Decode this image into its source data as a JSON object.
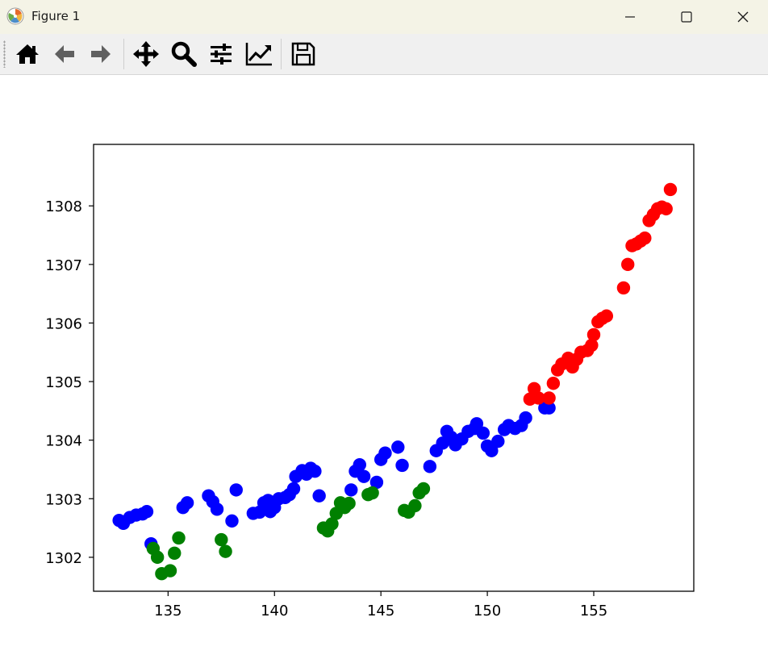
{
  "window": {
    "title": "Figure 1",
    "app_icon": "matplotlib-icon",
    "controls": [
      "minimize-icon",
      "maximize-icon",
      "close-icon"
    ]
  },
  "toolbar": {
    "buttons": [
      {
        "name": "home-button",
        "icon": "home-icon"
      },
      {
        "name": "back-button",
        "icon": "arrow-left-icon"
      },
      {
        "name": "forward-button",
        "icon": "arrow-right-icon"
      },
      {
        "name": "pan-button",
        "icon": "move-icon"
      },
      {
        "name": "zoom-button",
        "icon": "magnifier-icon"
      },
      {
        "name": "subplots-button",
        "icon": "sliders-icon"
      },
      {
        "name": "edit-axis-button",
        "icon": "line-chart-icon"
      },
      {
        "name": "save-button",
        "icon": "floppy-disk-icon"
      }
    ]
  },
  "chart_data": {
    "type": "scatter",
    "xlim": [
      131.5,
      159.7
    ],
    "ylim": [
      1301.42,
      1309.05
    ],
    "x_ticks": [
      135,
      140,
      145,
      150,
      155
    ],
    "y_ticks": [
      1302,
      1303,
      1304,
      1305,
      1306,
      1307,
      1308
    ],
    "grid": false,
    "series": [
      {
        "color": "#0000ff",
        "points": [
          [
            132.7,
            1302.63
          ],
          [
            132.9,
            1302.58
          ],
          [
            133.2,
            1302.68
          ],
          [
            133.5,
            1302.72
          ],
          [
            133.8,
            1302.74
          ],
          [
            134.0,
            1302.78
          ],
          [
            134.2,
            1302.23
          ],
          [
            135.7,
            1302.85
          ],
          [
            135.9,
            1302.93
          ],
          [
            136.9,
            1303.05
          ],
          [
            137.1,
            1302.95
          ],
          [
            137.3,
            1302.82
          ],
          [
            138.0,
            1302.62
          ],
          [
            138.2,
            1303.15
          ],
          [
            139.0,
            1302.75
          ],
          [
            139.3,
            1302.77
          ],
          [
            139.5,
            1302.93
          ],
          [
            139.7,
            1302.97
          ],
          [
            139.8,
            1302.78
          ],
          [
            140.0,
            1302.85
          ],
          [
            140.2,
            1303.0
          ],
          [
            140.5,
            1303.02
          ],
          [
            140.7,
            1303.07
          ],
          [
            140.9,
            1303.17
          ],
          [
            141.0,
            1303.38
          ],
          [
            141.3,
            1303.48
          ],
          [
            141.5,
            1303.42
          ],
          [
            141.7,
            1303.52
          ],
          [
            141.9,
            1303.47
          ],
          [
            142.1,
            1303.05
          ],
          [
            143.6,
            1303.15
          ],
          [
            143.8,
            1303.47
          ],
          [
            144.0,
            1303.58
          ],
          [
            144.2,
            1303.38
          ],
          [
            144.8,
            1303.28
          ],
          [
            145.0,
            1303.67
          ],
          [
            145.2,
            1303.78
          ],
          [
            145.8,
            1303.88
          ],
          [
            146.0,
            1303.57
          ],
          [
            147.3,
            1303.55
          ],
          [
            147.6,
            1303.82
          ],
          [
            147.9,
            1303.95
          ],
          [
            148.1,
            1304.15
          ],
          [
            148.3,
            1304.05
          ],
          [
            148.5,
            1303.92
          ],
          [
            148.8,
            1304.02
          ],
          [
            149.1,
            1304.15
          ],
          [
            149.4,
            1304.2
          ],
          [
            149.5,
            1304.28
          ],
          [
            149.8,
            1304.12
          ],
          [
            150.0,
            1303.9
          ],
          [
            150.2,
            1303.82
          ],
          [
            150.5,
            1303.98
          ],
          [
            150.8,
            1304.18
          ],
          [
            151.0,
            1304.25
          ],
          [
            151.3,
            1304.2
          ],
          [
            151.6,
            1304.25
          ],
          [
            151.8,
            1304.38
          ],
          [
            152.7,
            1304.55
          ],
          [
            152.9,
            1304.55
          ]
        ]
      },
      {
        "color": "#008000",
        "points": [
          [
            134.3,
            1302.15
          ],
          [
            134.5,
            1302.0
          ],
          [
            134.7,
            1301.72
          ],
          [
            135.1,
            1301.77
          ],
          [
            135.3,
            1302.07
          ],
          [
            135.5,
            1302.33
          ],
          [
            137.5,
            1302.3
          ],
          [
            137.7,
            1302.1
          ],
          [
            142.3,
            1302.5
          ],
          [
            142.5,
            1302.45
          ],
          [
            142.7,
            1302.57
          ],
          [
            142.9,
            1302.75
          ],
          [
            143.1,
            1302.93
          ],
          [
            143.3,
            1302.85
          ],
          [
            143.5,
            1302.92
          ],
          [
            144.4,
            1303.07
          ],
          [
            144.6,
            1303.1
          ],
          [
            146.1,
            1302.8
          ],
          [
            146.3,
            1302.77
          ],
          [
            146.6,
            1302.88
          ],
          [
            146.8,
            1303.1
          ],
          [
            147.0,
            1303.17
          ]
        ]
      },
      {
        "color": "#ff0000",
        "points": [
          [
            152.0,
            1304.7
          ],
          [
            152.2,
            1304.88
          ],
          [
            152.4,
            1304.72
          ],
          [
            152.9,
            1304.72
          ],
          [
            153.1,
            1304.97
          ],
          [
            153.3,
            1305.2
          ],
          [
            153.5,
            1305.3
          ],
          [
            153.8,
            1305.4
          ],
          [
            154.0,
            1305.25
          ],
          [
            154.2,
            1305.38
          ],
          [
            154.4,
            1305.5
          ],
          [
            154.7,
            1305.53
          ],
          [
            154.9,
            1305.62
          ],
          [
            155.0,
            1305.8
          ],
          [
            155.2,
            1306.02
          ],
          [
            155.4,
            1306.08
          ],
          [
            155.6,
            1306.12
          ],
          [
            156.4,
            1306.6
          ],
          [
            156.6,
            1307.0
          ],
          [
            156.8,
            1307.32
          ],
          [
            157.0,
            1307.35
          ],
          [
            157.2,
            1307.4
          ],
          [
            157.4,
            1307.45
          ],
          [
            157.6,
            1307.75
          ],
          [
            157.8,
            1307.85
          ],
          [
            158.0,
            1307.95
          ],
          [
            158.2,
            1307.98
          ],
          [
            158.4,
            1307.95
          ],
          [
            158.6,
            1308.28
          ]
        ]
      }
    ]
  }
}
